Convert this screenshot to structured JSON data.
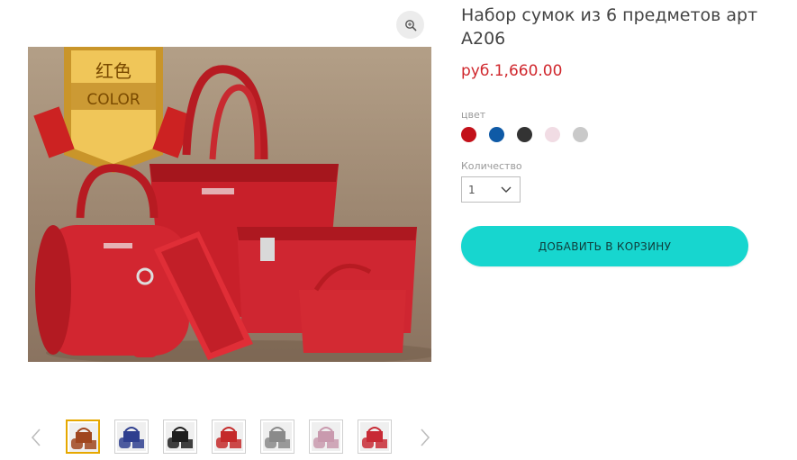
{
  "gallery": {
    "zoom_icon": "magnifier-zoom-icon",
    "main_image_alt": "Red crocodile-pattern handbag set",
    "badge_text_cn": "红色",
    "badge_text_en": "COLOR",
    "prev_icon": "chevron-left-icon",
    "next_icon": "chevron-right-icon",
    "thumbnails": [
      {
        "color": "#a0461f",
        "active": true
      },
      {
        "color": "#2f3f8f",
        "active": false
      },
      {
        "color": "#1e1e1e",
        "active": false
      },
      {
        "color": "#c42a2a",
        "active": false
      },
      {
        "color": "#8a8a8a",
        "active": false
      },
      {
        "color": "#c99aae",
        "active": false
      },
      {
        "color": "#c82a35",
        "active": false
      }
    ]
  },
  "product": {
    "title": "Набор сумок из 6 предметов арт A206",
    "price": "руб.1,660.00",
    "color_label": "цвет",
    "colors": [
      "#c3111a",
      "#0f5aa6",
      "#333333",
      "#f1dce4",
      "#c9c9c9"
    ],
    "quantity_label": "Количество",
    "quantity_value": "1",
    "add_to_cart": "ДОБАВИТЬ В КОРЗИНУ"
  },
  "accent_colors": {
    "price": "#d0272d",
    "button": "#17d6cf",
    "active_thumb_border": "#e6a800"
  }
}
